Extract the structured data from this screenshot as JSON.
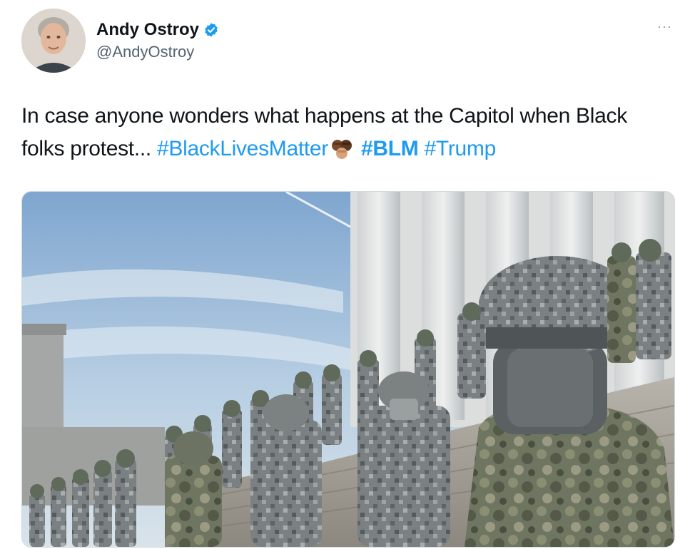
{
  "tweet": {
    "author": {
      "display_name": "Andy Ostroy",
      "handle": "@AndyOstroy",
      "verified": true
    },
    "text_prefix": "In case anyone wonders what happens at the Capitol when Black folks protest... ",
    "hashtags": [
      "#BlackLivesMatter",
      "#BLM",
      "#Trump"
    ],
    "emoji": "fists-raised-emoji",
    "media": {
      "kind": "photo",
      "description_icon": "photo-icon"
    },
    "more_label": "···"
  },
  "colors": {
    "link": "#1d9bf0",
    "text": "#0f1419",
    "secondary": "#536471",
    "verified": "#1d9bf0"
  }
}
